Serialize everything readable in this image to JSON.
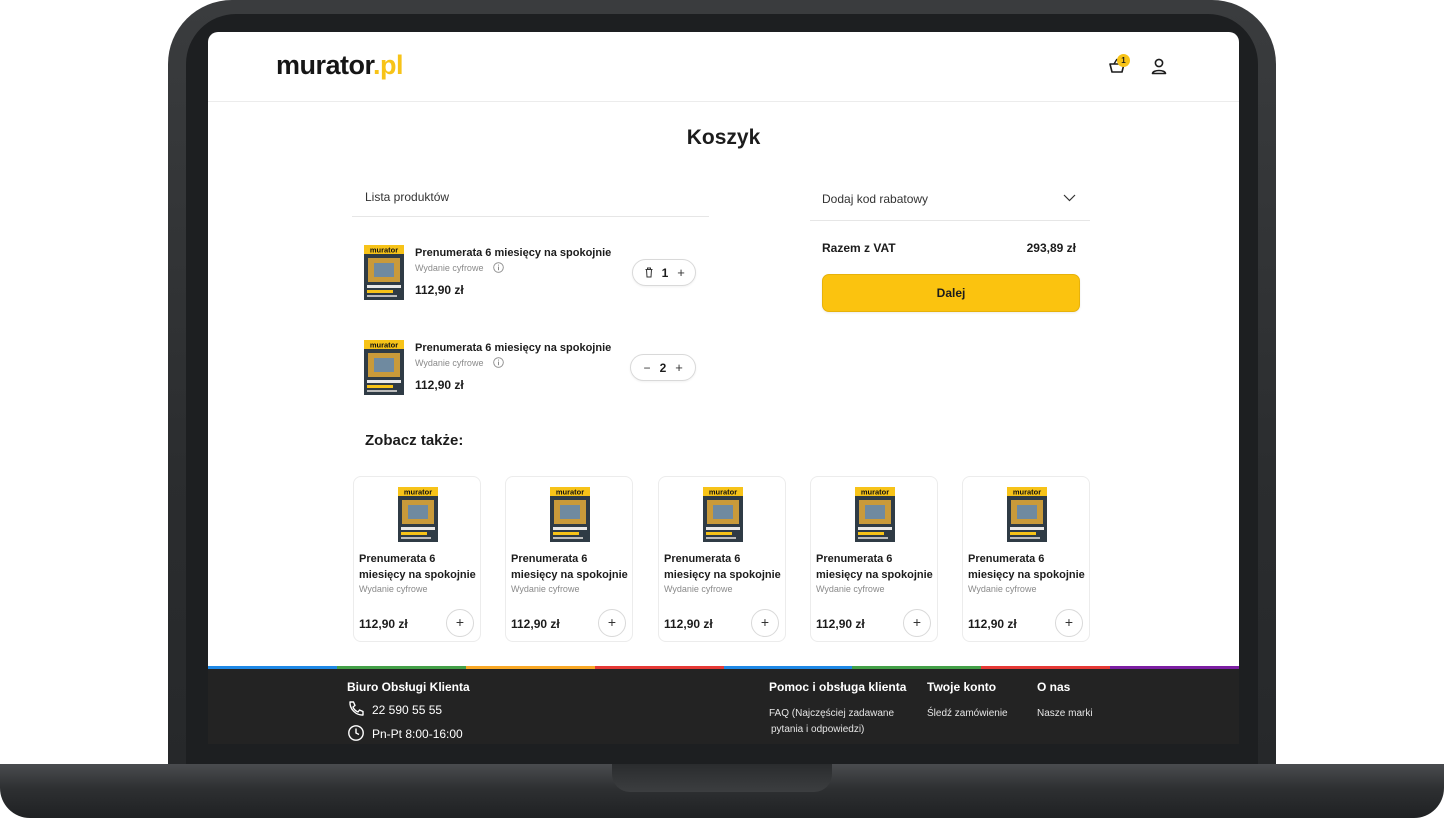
{
  "header": {
    "logo_text": "murator",
    "logo_suffix": ".pl",
    "cart_count": "1"
  },
  "page_title": "Koszyk",
  "product_list": {
    "header": "Lista produktów",
    "items": [
      {
        "name": "Prenumerata 6 miesięcy na spokojnie",
        "subtitle": "Wydanie cyfrowe",
        "price": "112,90 zł",
        "quantity": "1",
        "left_action_icon": "trash-icon",
        "right_action_icon": "plus-icon"
      },
      {
        "name": "Prenumerata 6 miesięcy na spokojnie",
        "subtitle": "Wydanie cyfrowe",
        "price": "112,90 zł",
        "quantity": "2",
        "left_action_icon": "minus-icon",
        "right_action_icon": "plus-icon"
      }
    ]
  },
  "summary": {
    "discount_label": "Dodaj kod rabatowy",
    "total_label": "Razem z VAT",
    "total_value": "293,89 zł",
    "next_button": "Dalej"
  },
  "see_also": {
    "title": "Zobacz także:",
    "cards": [
      {
        "name": "Prenumerata 6 miesięcy na spokojnie",
        "subtitle": "Wydanie cyfrowe",
        "price": "112,90 zł"
      },
      {
        "name": "Prenumerata 6 miesięcy na spokojnie",
        "subtitle": "Wydanie cyfrowe",
        "price": "112,90 zł"
      },
      {
        "name": "Prenumerata 6 miesięcy na spokojnie",
        "subtitle": "Wydanie cyfrowe",
        "price": "112,90 zł"
      },
      {
        "name": "Prenumerata 6 miesięcy na spokojnie",
        "subtitle": "Wydanie cyfrowe",
        "price": "112,90 zł"
      },
      {
        "name": "Prenumerata 6 miesięcy na spokojnie",
        "subtitle": "Wydanie cyfrowe",
        "price": "112,90 zł"
      }
    ]
  },
  "footer": {
    "office_title": "Biuro Obsługi Klienta",
    "phone": "22 590 55 55",
    "hours": "Pn-Pt 8:00-16:00",
    "help_title": "Pomoc i obsługa klienta",
    "help_link_1": "FAQ (Najczęściej zadawane",
    "help_link_2": "pytania i odpowiedzi)",
    "account_title": "Twoje konto",
    "account_link": "Śledź zamówienie",
    "about_title": "O nas",
    "about_link": "Nasze marki"
  },
  "colors": {
    "accent": "#fbc30f",
    "footer_bg": "#232323",
    "stripe": [
      "#1e88e5",
      "#43a047",
      "#f9a825",
      "#e53935",
      "#1e88e5",
      "#43a047",
      "#e53935",
      "#7b1fa2"
    ]
  }
}
